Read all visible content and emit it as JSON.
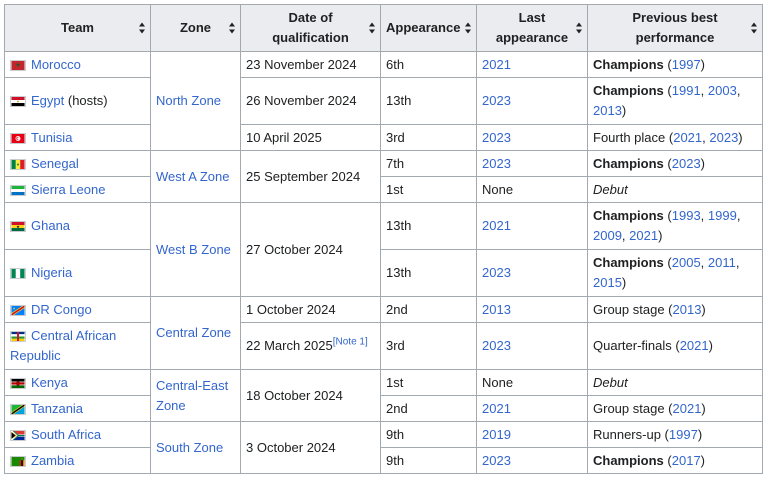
{
  "headers": {
    "team": "Team",
    "zone": "Zone",
    "date_l1": "Date of",
    "date_l2": "qualification",
    "appearance": "Appearance",
    "last_l1": "Last",
    "last_l2": "appearance",
    "prev_l1": "Previous best",
    "prev_l2": "performance"
  },
  "zones": {
    "north": "North Zone",
    "west_a": "West A Zone",
    "west_b": "West B Zone",
    "central": "Central Zone",
    "central_east_1": "Central-East",
    "central_east_2": "Zone",
    "south": "South Zone"
  },
  "teams": {
    "morocco": {
      "name": "Morocco",
      "date": "23 November 2024",
      "app": "6th",
      "last": "2021",
      "perf_bold": "Champions",
      "years": [
        "1997"
      ]
    },
    "egypt": {
      "name": "Egypt",
      "suffix": " (hosts)",
      "date": "26 November 2024",
      "app": "13th",
      "last": "2023",
      "perf_bold": "Champions",
      "years": [
        "1991",
        "2003",
        "2013"
      ]
    },
    "tunisia": {
      "name": "Tunisia",
      "date": "10 April 2025",
      "app": "3rd",
      "last": "2023",
      "perf_text": "Fourth place",
      "years": [
        "2021",
        "2023"
      ]
    },
    "senegal": {
      "name": "Senegal",
      "date": "25 September 2024",
      "app": "7th",
      "last": "2023",
      "perf_bold": "Champions",
      "years": [
        "2023"
      ]
    },
    "sierra_leone": {
      "name": "Sierra Leone",
      "app": "1st",
      "last": "None",
      "perf_italic": "Debut"
    },
    "ghana": {
      "name": "Ghana",
      "date": "27 October 2024",
      "app": "13th",
      "last": "2021",
      "perf_bold": "Champions",
      "years": [
        "1993",
        "1999",
        "2009",
        "2021"
      ]
    },
    "nigeria": {
      "name": "Nigeria",
      "app": "13th",
      "last": "2023",
      "perf_bold": "Champions",
      "years": [
        "2005",
        "2011",
        "2015"
      ]
    },
    "dr_congo": {
      "name": "DR Congo",
      "date": "1 October 2024",
      "app": "2nd",
      "last": "2013",
      "perf_text": "Group stage",
      "years": [
        "2013"
      ]
    },
    "car": {
      "name_l1": "Central African",
      "name_l2": "Republic",
      "date": "22 March 2025",
      "note": "[Note 1]",
      "app": "3rd",
      "last": "2023",
      "perf_text": "Quarter-finals",
      "years": [
        "2021"
      ]
    },
    "kenya": {
      "name": "Kenya",
      "date": "18 October 2024",
      "app": "1st",
      "last": "None",
      "perf_italic": "Debut"
    },
    "tanzania": {
      "name": "Tanzania",
      "app": "2nd",
      "last": "2021",
      "perf_text": "Group stage",
      "years": [
        "2021"
      ]
    },
    "south_africa": {
      "name": "South Africa",
      "date": "3 October 2024",
      "app": "9th",
      "last": "2019",
      "perf_text": "Runners-up",
      "years": [
        "1997"
      ]
    },
    "zambia": {
      "name": "Zambia",
      "app": "9th",
      "last": "2023",
      "perf_bold": "Champions",
      "years": [
        "2017"
      ]
    }
  },
  "punct": {
    "open": " (",
    "close": ")",
    "comma": ", "
  }
}
